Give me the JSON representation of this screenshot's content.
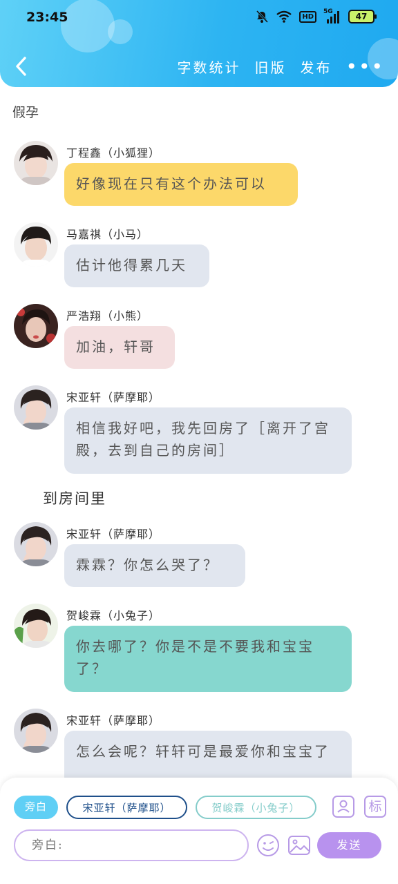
{
  "status_bar": {
    "time": "23:45",
    "network": "HD",
    "signal": "5G",
    "battery": "47"
  },
  "header": {
    "word_count": "字数统计",
    "old_version": "旧版",
    "publish": "发布",
    "more": "•••"
  },
  "story_title": "假孕",
  "messages": [
    {
      "name": "丁程鑫（小狐狸）",
      "text": "好像现在只有这个办法可以",
      "color": "#fcd86a"
    },
    {
      "name": "马嘉祺（小马）",
      "text": "估计他得累几天",
      "color": "#e1e6ef"
    },
    {
      "name": "严浩翔（小熊）",
      "text": "加油，轩哥",
      "color": "#f4dfe0"
    },
    {
      "name": "宋亚轩（萨摩耶）",
      "text": "相信我好吧，我先回房了［离开了宫殿，去到自己的房间］",
      "color": "#e1e6ef"
    },
    {
      "name": "宋亚轩（萨摩耶）",
      "text": "霖霖？你怎么哭了？",
      "color": "#e1e6ef"
    },
    {
      "name": "贺峻霖（小兔子）",
      "text": "你去哪了？你是不是不要我和宝宝了？",
      "color": "#86d7cf"
    },
    {
      "name": "宋亚轩（萨摩耶）",
      "text": "怎么会呢？轩轩可是最爱你和宝宝了",
      "color": "#e1e6ef"
    }
  ],
  "narration": "到房间里",
  "composer": {
    "chips": [
      "旁白",
      "宋亚轩（萨摩耶）",
      "贺峻霖（小兔子）"
    ],
    "placeholder": "旁白:",
    "send": "发送",
    "tag_icon_text": "标"
  },
  "colors": {
    "header": "#2db4f2",
    "accent": "#b892ee"
  }
}
